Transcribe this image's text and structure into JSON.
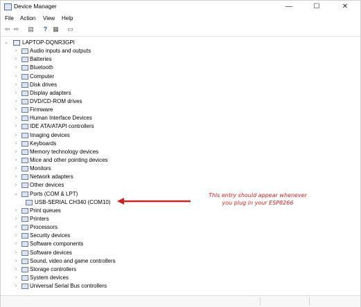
{
  "window": {
    "title": "Device Manager",
    "minimize": "—",
    "maximize": "☐",
    "close": "✕"
  },
  "menu": [
    "File",
    "Action",
    "View",
    "Help"
  ],
  "toolbar": {
    "back": "⇦",
    "forward": "⇨",
    "properties": "▤",
    "help": "?",
    "update": "▦",
    "monitor": "▭"
  },
  "tree": {
    "root": "LAPTOP-DQNR3GPI",
    "items": [
      {
        "label": "Audio inputs and outputs",
        "icon": "speaker-icon"
      },
      {
        "label": "Batteries",
        "icon": "battery-icon"
      },
      {
        "label": "Bluetooth",
        "icon": "bluetooth-icon"
      },
      {
        "label": "Computer",
        "icon": "computer-icon"
      },
      {
        "label": "Disk drives",
        "icon": "disk-icon"
      },
      {
        "label": "Display adapters",
        "icon": "display-icon"
      },
      {
        "label": "DVD/CD-ROM drives",
        "icon": "dvd-icon"
      },
      {
        "label": "Firmware",
        "icon": "firmware-icon"
      },
      {
        "label": "Human Interface Devices",
        "icon": "hid-icon"
      },
      {
        "label": "IDE ATA/ATAPI controllers",
        "icon": "ide-icon"
      },
      {
        "label": "Imaging devices",
        "icon": "camera-icon"
      },
      {
        "label": "Keyboards",
        "icon": "keyboard-icon"
      },
      {
        "label": "Memory technology devices",
        "icon": "memory-icon"
      },
      {
        "label": "Mice and other pointing devices",
        "icon": "mouse-icon"
      },
      {
        "label": "Monitors",
        "icon": "monitor-icon"
      },
      {
        "label": "Network adapters",
        "icon": "network-icon"
      },
      {
        "label": "Other devices",
        "icon": "other-devices-icon"
      },
      {
        "label": "Ports (COM & LPT)",
        "icon": "port-icon",
        "expanded": true
      },
      {
        "label": "USB-SERIAL CH340 (COM10)",
        "icon": "usb-serial-icon",
        "child": true
      },
      {
        "label": "Print queues",
        "icon": "printer-queue-icon"
      },
      {
        "label": "Printers",
        "icon": "printer-icon"
      },
      {
        "label": "Processors",
        "icon": "processor-icon"
      },
      {
        "label": "Security devices",
        "icon": "security-icon"
      },
      {
        "label": "Software components",
        "icon": "software-component-icon"
      },
      {
        "label": "Software devices",
        "icon": "software-device-icon"
      },
      {
        "label": "Sound, video and game controllers",
        "icon": "sound-icon"
      },
      {
        "label": "Storage controllers",
        "icon": "storage-icon"
      },
      {
        "label": "System devices",
        "icon": "system-icon"
      },
      {
        "label": "Universal Serial Bus controllers",
        "icon": "usb-icon"
      }
    ]
  },
  "annotation": {
    "line1": "This entry should appear whenever",
    "line2": "you plug in your ESP8266",
    "color": "#d02020"
  },
  "expander": {
    "collapsed": "›",
    "expanded": "⌄"
  }
}
